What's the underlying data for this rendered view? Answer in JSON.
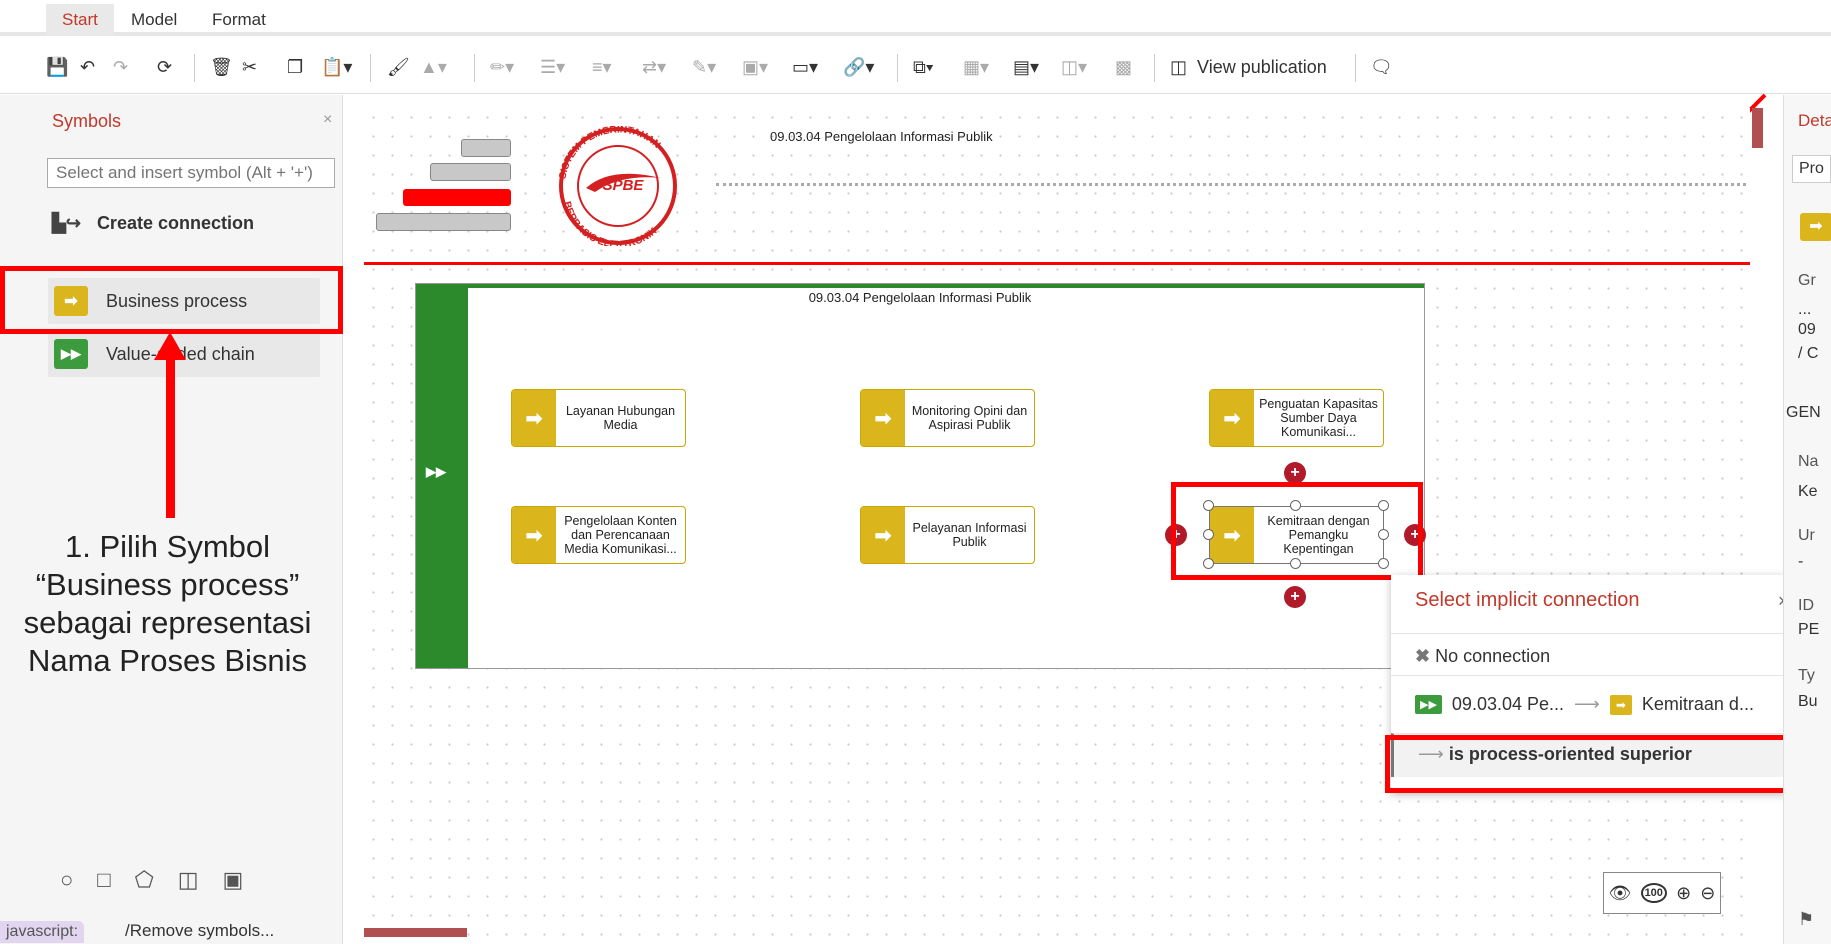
{
  "menu": {
    "tabs": [
      "Start",
      "Model",
      "Format"
    ]
  },
  "toolbar": {
    "view_publication": "View publication"
  },
  "symbols_panel": {
    "title": "Symbols",
    "close": "×",
    "search_placeholder": "Select and insert symbol (Alt + '+')",
    "create_connection": "Create connection",
    "items": [
      {
        "label": "Business process",
        "icon": "business-process-icon",
        "color": "#dab51b"
      },
      {
        "label": "Value-added chain",
        "icon": "value-added-chain-icon",
        "color": "#3c9b3c"
      }
    ]
  },
  "annotation": {
    "text": "1. Pilih Symbol “Business process” sebagai representasi Nama Proses Bisnis",
    "color": "#ff0000"
  },
  "canvas": {
    "header_title": "09.03.04 Pengelolaan Informasi Publik",
    "container_title": "09.03.04 Pengelolaan Informasi Publik",
    "logo_text_top": "SISTEM PEMERINTAHAN",
    "logo_text_center": "SPBE",
    "logo_text_bottom": "BERBASIS ELEKTRONIK",
    "processes": [
      {
        "label": "Layanan Hubungan Media"
      },
      {
        "label": "Monitoring Opini dan Aspirasi Publik"
      },
      {
        "label": "Penguatan Kapasitas Sumber Daya Komunikasi..."
      },
      {
        "label": "Pengelolaan Konten dan Perencanaan Media Komunikasi..."
      },
      {
        "label": "Pelayanan Informasi Publik"
      },
      {
        "label": "Kemitraan dengan Pemangku Kepentingan"
      }
    ]
  },
  "popup": {
    "title": "Select implicit connection",
    "close": "×",
    "no_connection": "No connection",
    "source": "09.03.04 Pe...",
    "arrow": "⟶",
    "target": "Kemitraan d...",
    "relation": "is process-oriented superior"
  },
  "right_panel": {
    "title": "Deta",
    "tab": "Pro",
    "group_label": "Gr",
    "group_value_1": "...",
    "group_value_2": "09",
    "group_value_3": "/ C",
    "section": "GEN",
    "name_label": "Na",
    "name_value": "Ke",
    "unit_label": "Ur",
    "unit_value": "-",
    "id_label": "ID",
    "id_value": "PE",
    "type_label": "Ty",
    "type_value": "Bu"
  },
  "status": {
    "js": "javascript:",
    "remove": "/Remove symbols..."
  },
  "zoom": {
    "fit": "100"
  }
}
